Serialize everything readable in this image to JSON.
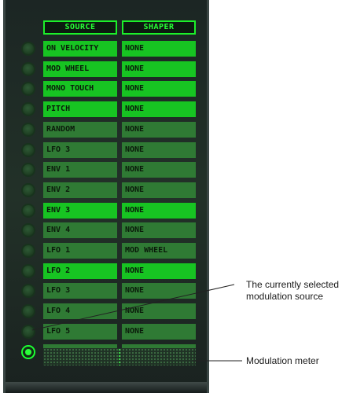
{
  "headers": {
    "source": "SOURCE",
    "shaper": "SHAPER"
  },
  "rows": [
    {
      "source": "ON VELOCITY",
      "shaper": "NONE",
      "active": true
    },
    {
      "source": "MOD WHEEL",
      "shaper": "NONE",
      "active": true
    },
    {
      "source": "MONO TOUCH",
      "shaper": "NONE",
      "active": true
    },
    {
      "source": "PITCH",
      "shaper": "NONE",
      "active": true
    },
    {
      "source": "RANDOM",
      "shaper": "NONE",
      "active": false
    },
    {
      "source": "LFO 3",
      "shaper": "NONE",
      "active": false
    },
    {
      "source": "ENV 1",
      "shaper": "NONE",
      "active": false
    },
    {
      "source": "ENV 2",
      "shaper": "NONE",
      "active": false
    },
    {
      "source": "ENV 3",
      "shaper": "NONE",
      "active": true
    },
    {
      "source": "ENV 4",
      "shaper": "NONE",
      "active": false
    },
    {
      "source": "LFO 1",
      "shaper": "MOD WHEEL",
      "active": false
    },
    {
      "source": "LFO 2",
      "shaper": "NONE",
      "active": true
    },
    {
      "source": "LFO 3",
      "shaper": "NONE",
      "active": false
    },
    {
      "source": "LFO 4",
      "shaper": "NONE",
      "active": false
    },
    {
      "source": "LFO 5",
      "shaper": "NONE",
      "active": false
    },
    {
      "source": "LFO 6",
      "shaper": "NONE",
      "active": false,
      "selected": true
    }
  ],
  "callouts": {
    "selected_line1": "The currently selected",
    "selected_line2": "modulation source",
    "meter": "Modulation meter"
  },
  "colors": {
    "active_cell": "#17c422",
    "inactive_cell": "#2f7a34",
    "led": "#27ff35"
  }
}
